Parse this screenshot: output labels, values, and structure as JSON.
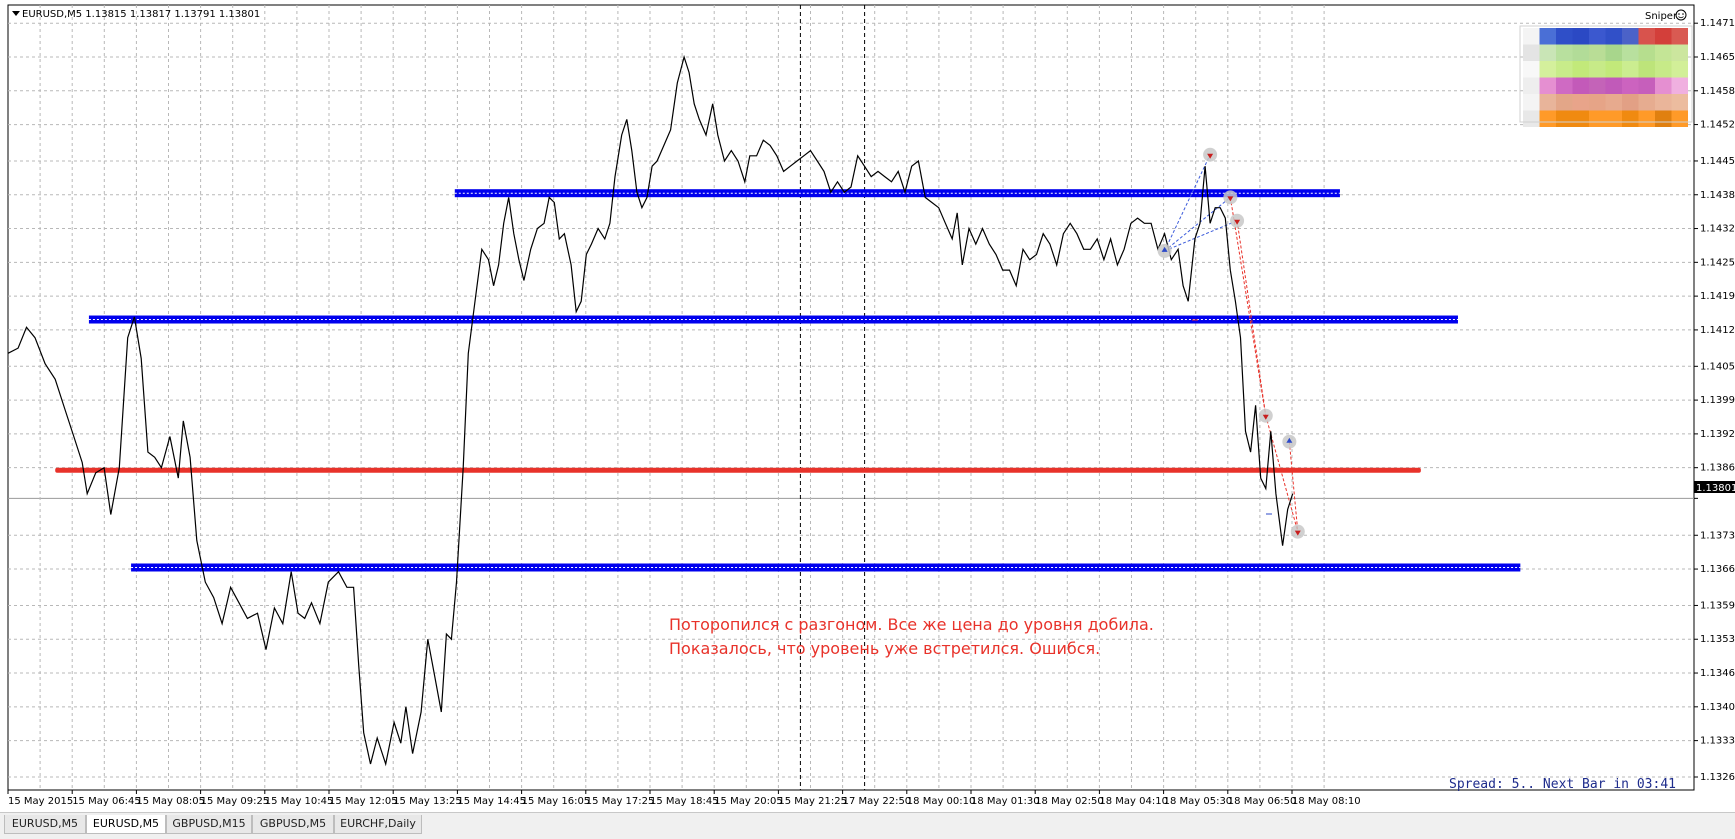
{
  "window": {
    "symbol_header": "EURUSD,M5  1.13815 1.13817 1.13791 1.13801",
    "indicator_name": "Sniper",
    "current_price_label": "1.13801"
  },
  "annotation": {
    "line1": "Поторопился с разгоном. Все же цена до уровня добила.",
    "line2": "Показалось, что уровень уже встретился. Ошибся."
  },
  "status": {
    "spread_text": "Spread: 5.. Next Bar in 03:41"
  },
  "tabs": [
    {
      "label": "EURUSD,M5",
      "active": false
    },
    {
      "label": "EURUSD,M5",
      "active": true
    },
    {
      "label": "GBPUSD,M15",
      "active": false
    },
    {
      "label": "GBPUSD,M5",
      "active": false
    },
    {
      "label": "EURCHF,Daily",
      "active": false
    }
  ],
  "colors": {
    "support_level": "#0000ee",
    "resistance_level": "#e8322a",
    "annotation_text": "#e8322a",
    "spread_text": "#1e2c8c",
    "price_line": "#000000"
  },
  "chart_data": {
    "type": "line",
    "symbol": "EURUSD",
    "timeframe": "M5",
    "ohlc_header": {
      "open": 1.13815,
      "high": 1.13817,
      "low": 1.13791,
      "close": 1.13801
    },
    "ylim": [
      1.1324,
      1.1475
    ],
    "grid": true,
    "y_ticks": [
      "1.14715",
      "1.14650",
      "1.14585",
      "1.14520",
      "1.14450",
      "1.14385",
      "1.14320",
      "1.14255",
      "1.14190",
      "1.14125",
      "1.14055",
      "1.13990",
      "1.13925",
      "1.13860",
      "1.13801",
      "1.13730",
      "1.13665",
      "1.13595",
      "1.13530",
      "1.13465",
      "1.13400",
      "1.13335",
      "1.13265"
    ],
    "x_ticks": [
      "15 May 2015",
      "15 May 06:45",
      "15 May 08:05",
      "15 May 09:25",
      "15 May 10:45",
      "15 May 12:05",
      "15 May 13:25",
      "15 May 14:45",
      "15 May 16:05",
      "15 May 17:25",
      "15 May 18:45",
      "15 May 20:05",
      "15 May 21:25",
      "17 May 22:50",
      "18 May 00:10",
      "18 May 01:30",
      "18 May 02:50",
      "18 May 04:10",
      "18 May 05:30",
      "18 May 06:50",
      "18 May 08:10"
    ],
    "session_separators": [
      "15 May 21:25",
      "17 May 22:50"
    ],
    "levels": [
      {
        "kind": "support",
        "color": "blue",
        "price": 1.14388,
        "from_bar": 0.265,
        "to_bar": 0.79
      },
      {
        "kind": "support",
        "color": "blue",
        "price": 1.14145,
        "from_bar": 0.048,
        "to_bar": 0.86
      },
      {
        "kind": "resistance",
        "color": "red",
        "price": 1.13855,
        "from_bar": 0.028,
        "to_bar": 0.838
      },
      {
        "kind": "support",
        "color": "blue",
        "price": 1.13668,
        "from_bar": 0.073,
        "to_bar": 0.897
      }
    ],
    "series": [
      {
        "values": [
          [
            0,
            1.1408
          ],
          [
            0.006,
            1.1409
          ],
          [
            0.011,
            1.1413
          ],
          [
            0.016,
            1.1411
          ],
          [
            0.022,
            1.1406
          ],
          [
            0.028,
            1.1403
          ],
          [
            0.034,
            1.1397
          ],
          [
            0.039,
            1.1392
          ],
          [
            0.044,
            1.1387
          ],
          [
            0.047,
            1.1381
          ],
          [
            0.052,
            1.1385
          ],
          [
            0.057,
            1.1386
          ],
          [
            0.061,
            1.1377
          ],
          [
            0.066,
            1.1386
          ],
          [
            0.071,
            1.1411
          ],
          [
            0.075,
            1.1415
          ],
          [
            0.079,
            1.1407
          ],
          [
            0.083,
            1.1389
          ],
          [
            0.087,
            1.1388
          ],
          [
            0.091,
            1.1386
          ],
          [
            0.096,
            1.1392
          ],
          [
            0.101,
            1.1384
          ],
          [
            0.104,
            1.1395
          ],
          [
            0.108,
            1.1388
          ],
          [
            0.112,
            1.1372
          ],
          [
            0.117,
            1.1364
          ],
          [
            0.122,
            1.1361
          ],
          [
            0.127,
            1.1356
          ],
          [
            0.132,
            1.1363
          ],
          [
            0.137,
            1.136
          ],
          [
            0.142,
            1.1357
          ],
          [
            0.148,
            1.1358
          ],
          [
            0.153,
            1.1351
          ],
          [
            0.158,
            1.1359
          ],
          [
            0.163,
            1.1356
          ],
          [
            0.168,
            1.1366
          ],
          [
            0.172,
            1.1358
          ],
          [
            0.176,
            1.1357
          ],
          [
            0.18,
            1.136
          ],
          [
            0.185,
            1.1356
          ],
          [
            0.19,
            1.1364
          ],
          [
            0.196,
            1.1366
          ],
          [
            0.201,
            1.1363
          ],
          [
            0.205,
            1.1363
          ],
          [
            0.208,
            1.1348
          ],
          [
            0.211,
            1.1335
          ],
          [
            0.215,
            1.1329
          ],
          [
            0.219,
            1.1334
          ],
          [
            0.224,
            1.1329
          ],
          [
            0.229,
            1.1337
          ],
          [
            0.233,
            1.1333
          ],
          [
            0.236,
            1.134
          ],
          [
            0.24,
            1.1331
          ],
          [
            0.245,
            1.1339
          ],
          [
            0.249,
            1.1353
          ],
          [
            0.253,
            1.1346
          ],
          [
            0.257,
            1.1339
          ],
          [
            0.26,
            1.1354
          ],
          [
            0.263,
            1.1353
          ],
          [
            0.266,
            1.1364
          ],
          [
            0.27,
            1.1386
          ],
          [
            0.273,
            1.1408
          ],
          [
            0.277,
            1.1418
          ],
          [
            0.281,
            1.1428
          ],
          [
            0.285,
            1.1426
          ],
          [
            0.288,
            1.1421
          ],
          [
            0.291,
            1.1425
          ],
          [
            0.294,
            1.1433
          ],
          [
            0.297,
            1.1438
          ],
          [
            0.3,
            1.1431
          ],
          [
            0.303,
            1.1426
          ],
          [
            0.306,
            1.1422
          ],
          [
            0.31,
            1.1428
          ],
          [
            0.314,
            1.1432
          ],
          [
            0.318,
            1.1433
          ],
          [
            0.321,
            1.1438
          ],
          [
            0.324,
            1.1437
          ],
          [
            0.327,
            1.143
          ],
          [
            0.33,
            1.1431
          ],
          [
            0.334,
            1.1425
          ],
          [
            0.337,
            1.1416
          ],
          [
            0.34,
            1.1418
          ],
          [
            0.343,
            1.1427
          ],
          [
            0.346,
            1.1429
          ],
          [
            0.35,
            1.1432
          ],
          [
            0.354,
            1.143
          ],
          [
            0.357,
            1.1433
          ],
          [
            0.36,
            1.1442
          ],
          [
            0.364,
            1.145
          ],
          [
            0.367,
            1.1453
          ],
          [
            0.37,
            1.1447
          ],
          [
            0.373,
            1.1439
          ],
          [
            0.376,
            1.1436
          ],
          [
            0.379,
            1.1438
          ],
          [
            0.382,
            1.1444
          ],
          [
            0.385,
            1.1445
          ],
          [
            0.389,
            1.1448
          ],
          [
            0.393,
            1.1451
          ],
          [
            0.397,
            1.146
          ],
          [
            0.401,
            1.1465
          ],
          [
            0.404,
            1.1462
          ],
          [
            0.407,
            1.1456
          ],
          [
            0.41,
            1.1453
          ],
          [
            0.414,
            1.145
          ],
          [
            0.418,
            1.1456
          ],
          [
            0.421,
            1.145
          ],
          [
            0.425,
            1.1445
          ],
          [
            0.429,
            1.1447
          ],
          [
            0.433,
            1.1445
          ],
          [
            0.437,
            1.1441
          ],
          [
            0.44,
            1.1446
          ],
          [
            0.444,
            1.1446
          ],
          [
            0.448,
            1.1449
          ],
          [
            0.452,
            1.1448
          ],
          [
            0.456,
            1.1446
          ],
          [
            0.46,
            1.1443
          ],
          [
            0.464,
            1.1444
          ],
          [
            0.468,
            1.1445
          ],
          [
            0.472,
            1.1446
          ],
          [
            0.476,
            1.1447
          ],
          [
            0.48,
            1.1445
          ],
          [
            0.484,
            1.1443
          ],
          [
            0.488,
            1.1439
          ],
          [
            0.492,
            1.1441
          ],
          [
            0.496,
            1.1439
          ],
          [
            0.5,
            1.144
          ],
          [
            0.504,
            1.1446
          ],
          [
            0.508,
            1.1444
          ],
          [
            0.512,
            1.1442
          ],
          [
            0.516,
            1.1443
          ],
          [
            0.52,
            1.1442
          ],
          [
            0.524,
            1.1441
          ],
          [
            0.528,
            1.1443
          ],
          [
            0.532,
            1.1439
          ],
          [
            0.536,
            1.1444
          ],
          [
            0.54,
            1.1445
          ],
          [
            0.544,
            1.1438
          ],
          [
            0.548,
            1.1437
          ],
          [
            0.552,
            1.1436
          ],
          [
            0.556,
            1.1433
          ],
          [
            0.56,
            1.143
          ],
          [
            0.563,
            1.1435
          ],
          [
            0.566,
            1.1425
          ],
          [
            0.57,
            1.1432
          ],
          [
            0.574,
            1.1429
          ],
          [
            0.578,
            1.1432
          ],
          [
            0.582,
            1.1429
          ],
          [
            0.586,
            1.1427
          ],
          [
            0.59,
            1.1424
          ],
          [
            0.594,
            1.1424
          ],
          [
            0.598,
            1.1421
          ],
          [
            0.602,
            1.1428
          ],
          [
            0.606,
            1.1426
          ],
          [
            0.61,
            1.1427
          ],
          [
            0.614,
            1.1431
          ],
          [
            0.618,
            1.1429
          ],
          [
            0.622,
            1.1425
          ],
          [
            0.626,
            1.1431
          ],
          [
            0.63,
            1.1433
          ],
          [
            0.634,
            1.1431
          ],
          [
            0.638,
            1.1428
          ],
          [
            0.642,
            1.1428
          ],
          [
            0.646,
            1.143
          ],
          [
            0.65,
            1.1426
          ],
          [
            0.654,
            1.143
          ],
          [
            0.658,
            1.1425
          ],
          [
            0.662,
            1.1428
          ],
          [
            0.666,
            1.1433
          ],
          [
            0.67,
            1.1434
          ],
          [
            0.674,
            1.1433
          ],
          [
            0.678,
            1.1433
          ],
          [
            0.682,
            1.1428
          ],
          [
            0.686,
            1.1431
          ],
          [
            0.69,
            1.1426
          ],
          [
            0.694,
            1.1428
          ],
          [
            0.697,
            1.1421
          ],
          [
            0.7,
            1.1418
          ],
          [
            0.704,
            1.143
          ],
          [
            0.707,
            1.1433
          ],
          [
            0.71,
            1.1444
          ],
          [
            0.713,
            1.1433
          ],
          [
            0.716,
            1.1436
          ],
          [
            0.719,
            1.1436
          ],
          [
            0.722,
            1.1434
          ],
          [
            0.725,
            1.1424
          ],
          [
            0.728,
            1.1418
          ],
          [
            0.731,
            1.1411
          ],
          [
            0.734,
            1.1393
          ],
          [
            0.737,
            1.1389
          ],
          [
            0.74,
            1.1398
          ],
          [
            0.743,
            1.1384
          ],
          [
            0.746,
            1.1382
          ],
          [
            0.749,
            1.1393
          ],
          [
            0.752,
            1.1381
          ],
          [
            0.756,
            1.1371
          ],
          [
            0.759,
            1.1378
          ],
          [
            0.762,
            1.1381
          ]
        ],
        "color": "#000000"
      }
    ],
    "signals": [
      {
        "bar": 0.686,
        "price": 1.14277,
        "type": "buy-arrow"
      },
      {
        "bar": 0.713,
        "price": 1.14462,
        "type": "sell-arrow"
      },
      {
        "bar": 0.725,
        "price": 1.1438,
        "type": "sell-arrow"
      },
      {
        "bar": 0.729,
        "price": 1.14335,
        "type": "sell-arrow"
      },
      {
        "bar": 0.746,
        "price": 1.1396,
        "type": "sell-arrow"
      },
      {
        "bar": 0.76,
        "price": 1.1391,
        "type": "buy-arrow"
      },
      {
        "bar": 0.765,
        "price": 1.13737,
        "type": "sell-arrow"
      }
    ]
  }
}
